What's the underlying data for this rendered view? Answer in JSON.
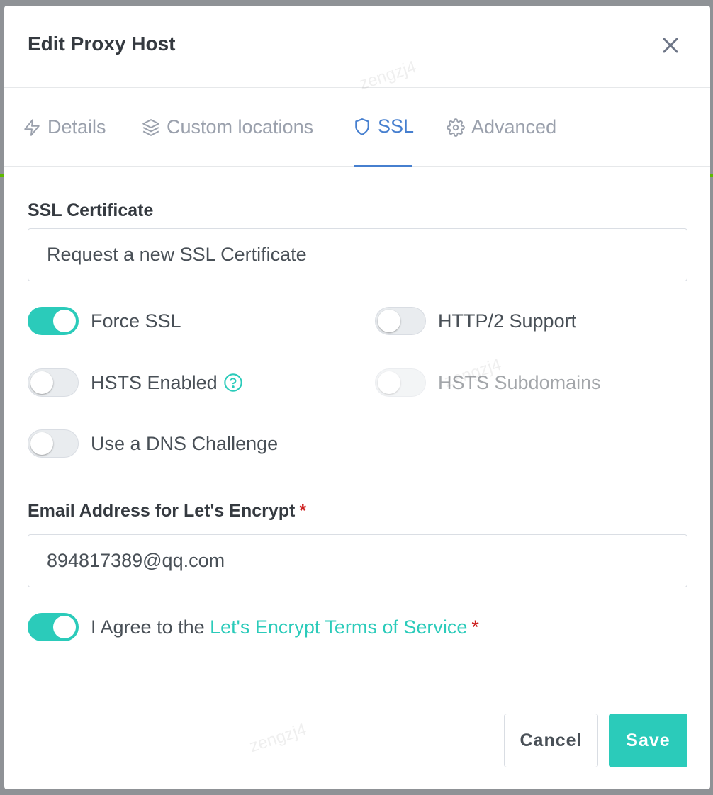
{
  "modal": {
    "title": "Edit Proxy Host"
  },
  "tabs": [
    {
      "label": "Details",
      "icon": "zap-icon",
      "active": false
    },
    {
      "label": "Custom locations",
      "icon": "layers-icon",
      "active": false
    },
    {
      "label": "SSL",
      "icon": "shield-icon",
      "active": true
    },
    {
      "label": "Advanced",
      "icon": "gear-icon",
      "active": false
    }
  ],
  "ssl": {
    "certificate_label": "SSL Certificate",
    "certificate_value": "Request a new SSL Certificate",
    "switches": {
      "force_ssl": {
        "label": "Force SSL",
        "on": true
      },
      "http2": {
        "label": "HTTP/2 Support",
        "on": false
      },
      "hsts": {
        "label": "HSTS Enabled",
        "on": false
      },
      "hsts_subdomains": {
        "label": "HSTS Subdomains",
        "on": false,
        "disabled": true
      },
      "dns_challenge": {
        "label": "Use a DNS Challenge",
        "on": false
      }
    },
    "email_label": "Email Address for Let's Encrypt",
    "required_mark": "*",
    "email_value": "894817389@qq.com",
    "agree_prefix": "I Agree to the ",
    "agree_link": "Let's Encrypt Terms of Service",
    "agree_on": true
  },
  "footer": {
    "cancel_label": "Cancel",
    "save_label": "Save"
  },
  "watermark": "zengzj4",
  "colors": {
    "accent_teal": "#2bcbba",
    "active_tab_blue": "#467fcf",
    "required_red": "#cd201f"
  }
}
